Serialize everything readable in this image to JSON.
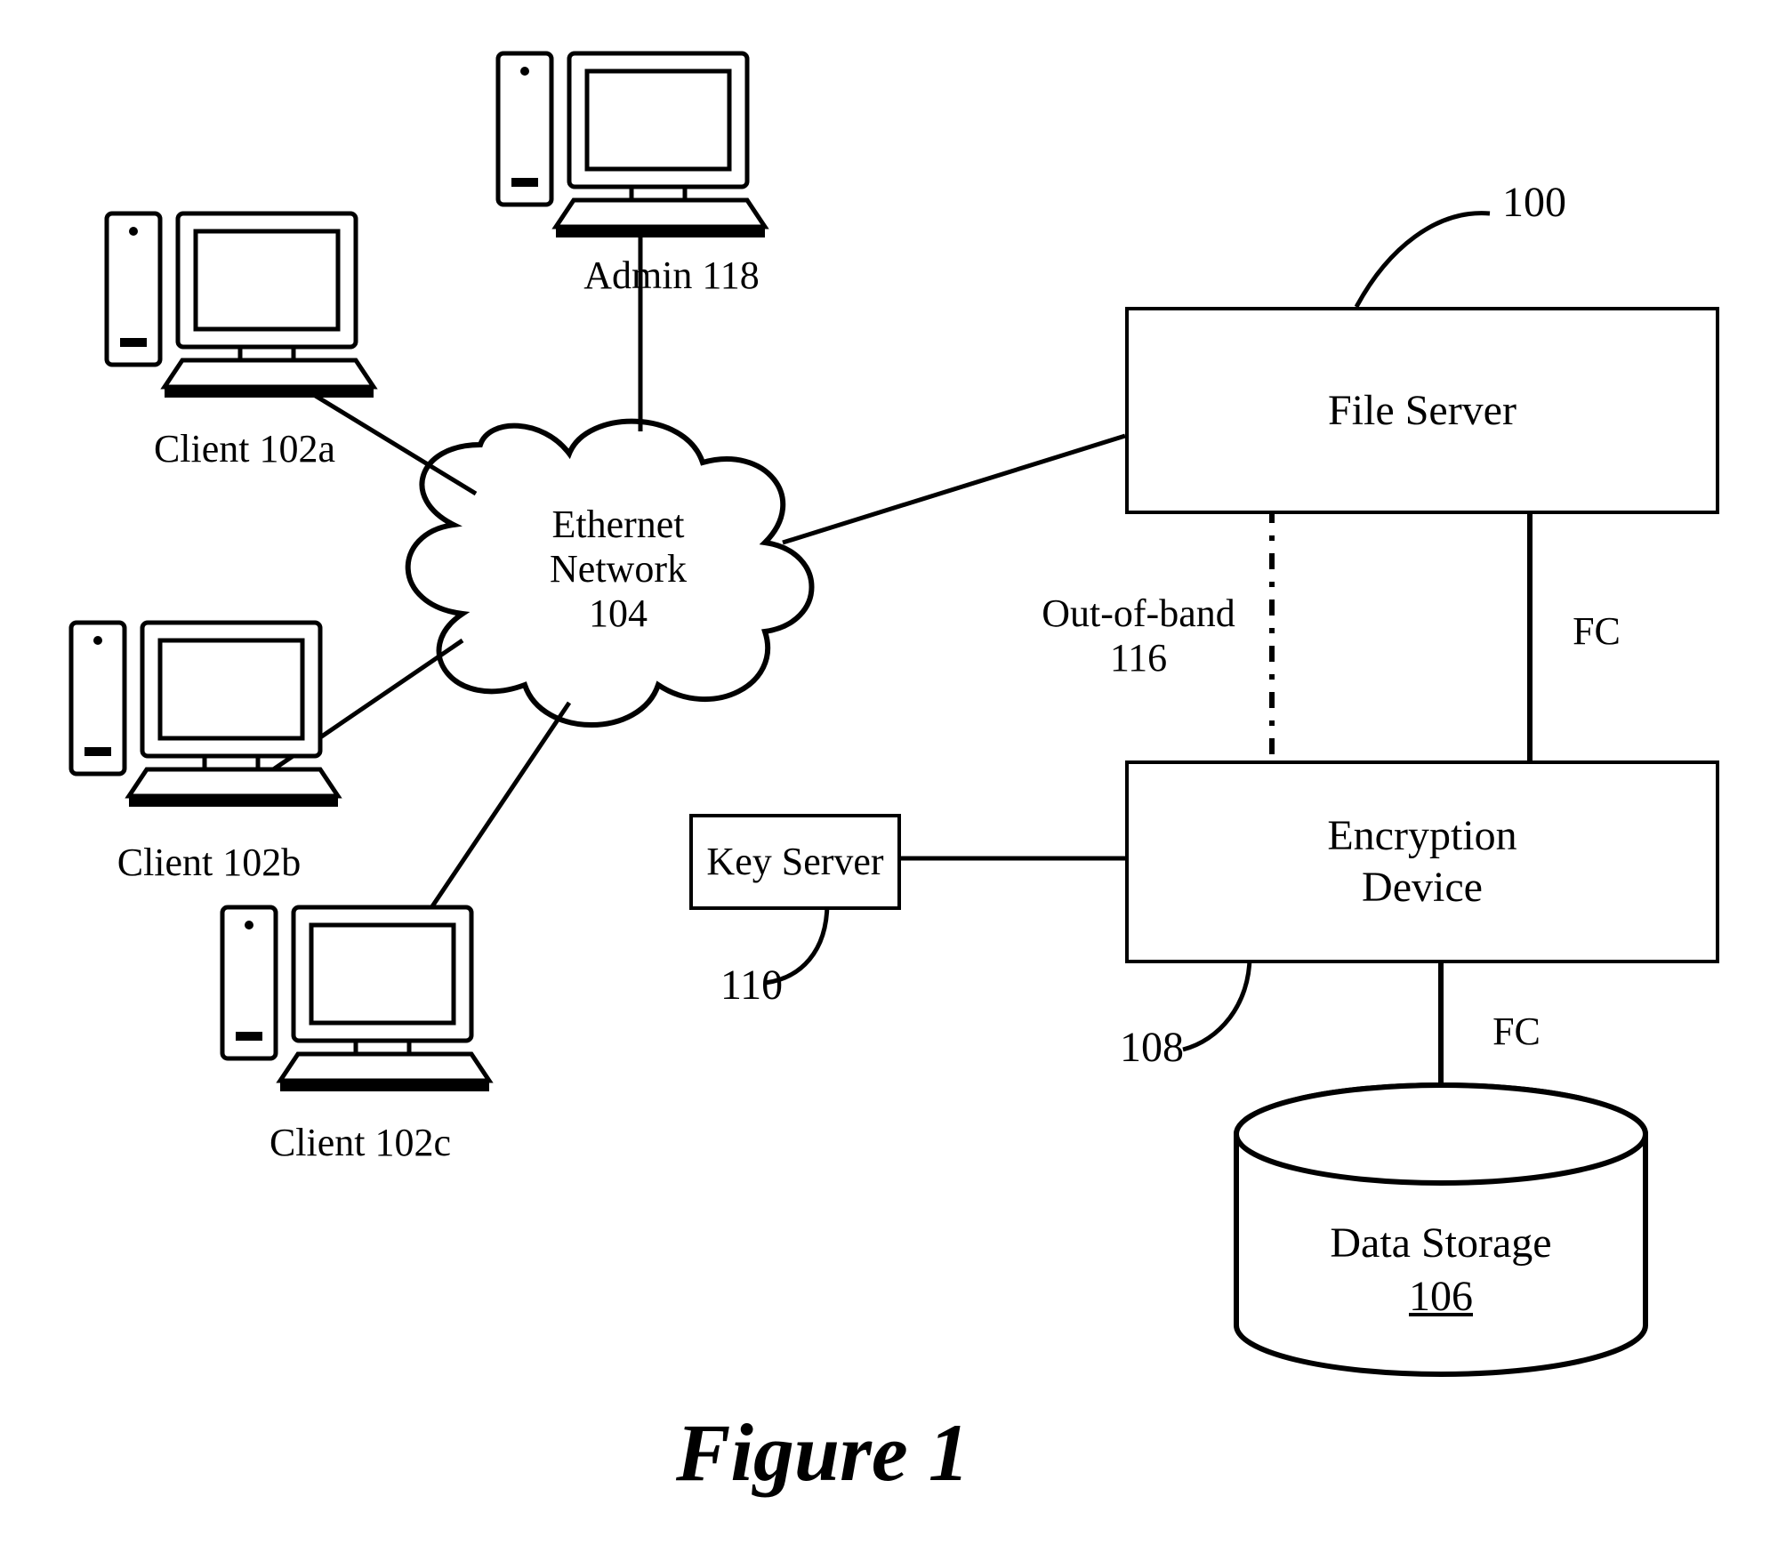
{
  "title": "Figure 1",
  "nodes": {
    "admin": {
      "label": "Admin 118"
    },
    "client_a": {
      "label": "Client 102a"
    },
    "client_b": {
      "label": "Client 102b"
    },
    "client_c": {
      "label": "Client 102c"
    },
    "cloud": {
      "line1": "Ethernet",
      "line2": "Network",
      "line3": "104"
    },
    "file_server": {
      "label": "File Server",
      "ref": "100"
    },
    "enc_device": {
      "line1": "Encryption",
      "line2": "Device",
      "ref": "108"
    },
    "key_server": {
      "label": "Key Server",
      "ref": "110"
    },
    "storage": {
      "label": "Data Storage",
      "ref": "106"
    }
  },
  "links": {
    "oob": {
      "line1": "Out-of-band",
      "line2": "116"
    },
    "fc1": {
      "label": "FC"
    },
    "fc2": {
      "label": "FC"
    }
  }
}
